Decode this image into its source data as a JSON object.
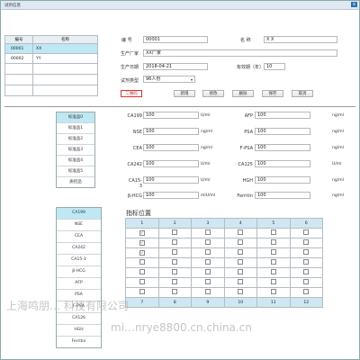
{
  "window": {
    "title": "试剂信息",
    "close": "x"
  },
  "left_table": {
    "headers": [
      "编号",
      "名称"
    ],
    "rows": [
      [
        "00001",
        "XX"
      ],
      [
        "00002",
        "YY"
      ]
    ]
  },
  "form": {
    "code_label": "编    号",
    "code_value": "00001",
    "name_label": "名    称",
    "name_value": "X X",
    "maker_label": "生产厂家",
    "maker_value": "XX厂家",
    "date_label": "生产日期",
    "date_value": "2018-04-21",
    "valid_label": "有效期（年）",
    "valid_value": "10",
    "type_label": "试剂类型",
    "type_value": "96人份",
    "qr_button": "二维码"
  },
  "buttons": {
    "new": "新增",
    "edit": "修改",
    "delete": "删除",
    "save": "保存",
    "cancel": "取消"
  },
  "standards": [
    "标准品0",
    "标准品1",
    "标准品2",
    "标准品3",
    "标准品4",
    "标准品5",
    "质控品"
  ],
  "markers_left": [
    {
      "name": "CA199",
      "value": "100",
      "unit": "U/ml"
    },
    {
      "name": "NSE",
      "value": "100",
      "unit": "ng/ml"
    },
    {
      "name": "CEA",
      "value": "100",
      "unit": "ng/ml"
    },
    {
      "name": "CA242",
      "value": "100",
      "unit": "U/ml"
    },
    {
      "name": "CA15-3",
      "value": "100",
      "unit": "U/ml"
    },
    {
      "name": "β-HCG",
      "value": "100",
      "unit": "mIU/ml"
    }
  ],
  "markers_right": [
    {
      "name": "AFP",
      "value": "100",
      "unit": "ng/ml"
    },
    {
      "name": "PSA",
      "value": "100",
      "unit": "ng/ml"
    },
    {
      "name": "F-PSA",
      "value": "100",
      "unit": "ng/ml"
    },
    {
      "name": "CA125",
      "value": "100",
      "unit": "U/ml"
    },
    {
      "name": "HGH",
      "value": "100",
      "unit": "ng/ml"
    },
    {
      "name": "Ferritin",
      "value": "100",
      "unit": "ng/ml"
    }
  ],
  "indicator_list": [
    "CA199",
    "NSE",
    "CEA",
    "CA242",
    "CA15-3",
    "β-HCG",
    "AFP",
    "PSA",
    "F-PSA",
    "CA12б",
    "HGH",
    "Ferritin"
  ],
  "position": {
    "title": "指标位置",
    "top_headers": [
      "1",
      "2",
      "3",
      "4",
      "5",
      "6"
    ],
    "bottom_headers": [
      "7",
      "8",
      "9",
      "10",
      "11",
      "12"
    ],
    "checked_rows": 3,
    "total_rows": 7
  },
  "watermark": {
    "line1": "上海鸣朋… 科技有限公司",
    "line2": "mi…nrye8800.cn.china.cn"
  }
}
